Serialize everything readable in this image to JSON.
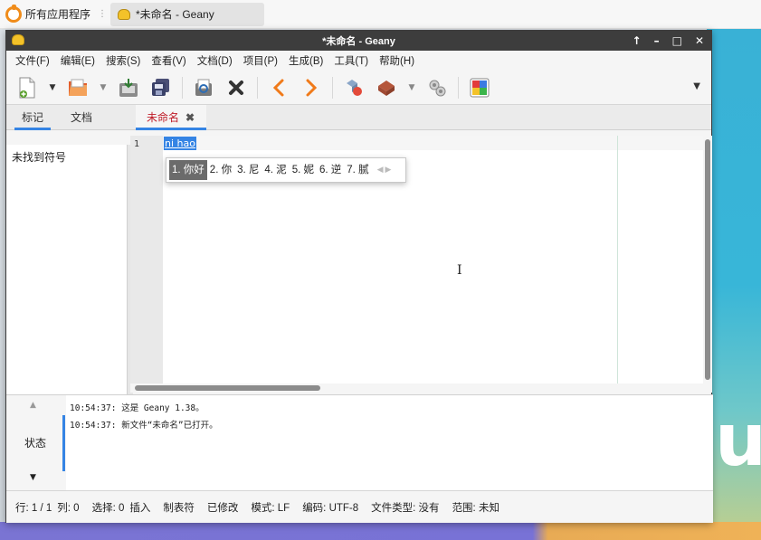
{
  "taskbar": {
    "launcher_label": "所有应用程序",
    "task_title": "*未命名 - Geany",
    "launcher_icon": "app-launcher-icon",
    "task_icon": "geany-icon"
  },
  "window": {
    "title": "*未命名 - Geany",
    "controls": [
      "↑",
      "–",
      "□",
      "✕"
    ]
  },
  "menubar": [
    "文件(F)",
    "编辑(E)",
    "搜索(S)",
    "查看(V)",
    "文档(D)",
    "项目(P)",
    "生成(B)",
    "工具(T)",
    "帮助(H)"
  ],
  "toolbar": {
    "icons": [
      "new-file-icon",
      "open-file-icon",
      "save-icon",
      "save-all-icon",
      "revert-icon",
      "close-icon",
      "back-icon",
      "forward-icon",
      "compile-icon",
      "build-icon",
      "execute-icon",
      "color-chooser-icon"
    ]
  },
  "sidebar": {
    "tabs": [
      "标记",
      "文档"
    ],
    "active_tab": "标记",
    "empty_text": "未找到符号"
  },
  "editor": {
    "tab_label": "未命名",
    "tab_close": "✖",
    "line_number": "1",
    "text": "ni hao"
  },
  "ime": {
    "candidates": [
      "1. 你好",
      "2. 你",
      "3. 尼",
      "4. 泥",
      "5. 妮",
      "6. 逆",
      "7. 腻"
    ],
    "selected_index": 0
  },
  "messages": {
    "tab_label": "状态",
    "lines": [
      "10:54:37: 这是 Geany 1.38。",
      "10:54:37: 新文件“未命名”已打开。"
    ]
  },
  "statusbar": [
    "行: 1 / 1",
    "列: 0",
    "选择: 0",
    "插入",
    "制表符",
    "已修改",
    "模式: LF",
    "编码: UTF-8",
    "文件类型: 没有",
    "范围: 未知"
  ],
  "colors": {
    "accent": "#3584e4",
    "titlebar": "#3d3d3d",
    "tab_modified": "#c01c28",
    "launcher_orange": "#f08c1a"
  }
}
